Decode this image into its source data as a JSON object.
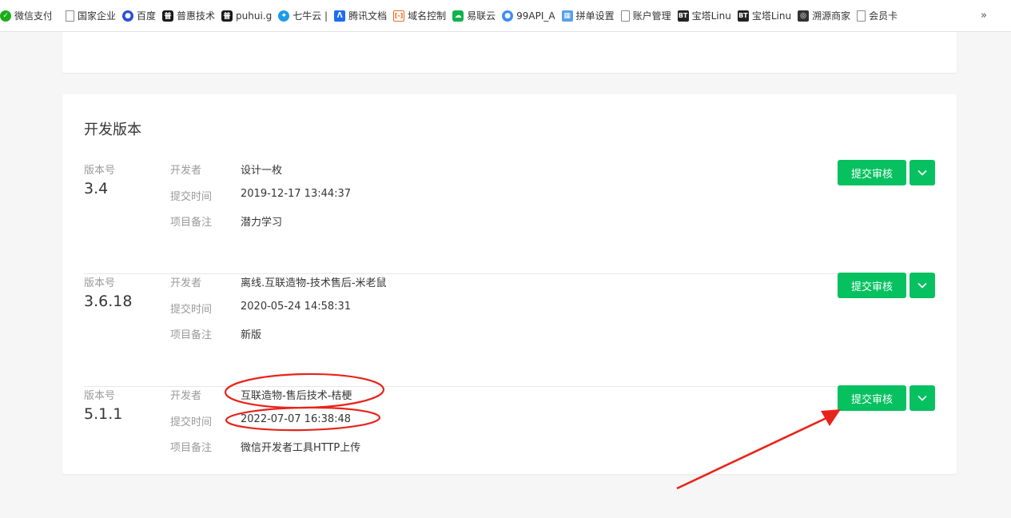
{
  "bookmarks": [
    {
      "label": "微信支付",
      "icon": "wechat-pay-icon"
    },
    {
      "label": "国家企业",
      "icon": "page-icon"
    },
    {
      "label": "百度",
      "icon": "baidu-paw-icon"
    },
    {
      "label": "普惠技术",
      "icon": "puhui-icon",
      "icon_glyph": "普"
    },
    {
      "label": "puhui.g",
      "icon": "puhui-icon",
      "icon_glyph": "普"
    },
    {
      "label": "七牛云 |",
      "icon": "qiniu-icon"
    },
    {
      "label": "腾讯文档",
      "icon": "tencent-docs-icon"
    },
    {
      "label": "域名控制",
      "icon": "aliyun-icon",
      "icon_glyph": "[-]"
    },
    {
      "label": "易联云",
      "icon": "cloud-icon"
    },
    {
      "label": "99API_A",
      "icon": "api-icon"
    },
    {
      "label": "拼单设置",
      "icon": "grid-icon"
    },
    {
      "label": "账户管理",
      "icon": "page-icon"
    },
    {
      "label": "宝塔Linu",
      "icon": "bt-icon",
      "icon_glyph": "BT"
    },
    {
      "label": "宝塔Linu",
      "icon": "bt-icon",
      "icon_glyph": "BT"
    },
    {
      "label": "溯源商家",
      "icon": "trace-icon"
    },
    {
      "label": "会员卡",
      "icon": "page-icon"
    }
  ],
  "bookmarks_more": "»",
  "section_title": "开发版本",
  "labels": {
    "version": "版本号",
    "developer": "开发者",
    "submit_time": "提交时间",
    "note": "项目备注",
    "submit_button": "提交审核"
  },
  "versions": [
    {
      "number": "3.4",
      "developer": "设计一枚",
      "time": "2019-12-17 13:44:37",
      "note": "潜力学习"
    },
    {
      "number": "3.6.18",
      "developer": "离线.互联造物-技术售后-米老鼠",
      "time": "2020-05-24 14:58:31",
      "note": "新版"
    },
    {
      "number": "5.1.1",
      "developer": "互联造物-售后技术-桔梗",
      "time": "2022-07-07 16:38:48",
      "note": "微信开发者工具HTTP上传"
    }
  ],
  "colors": {
    "accent": "#07c160",
    "annotation": "#e8231b"
  }
}
